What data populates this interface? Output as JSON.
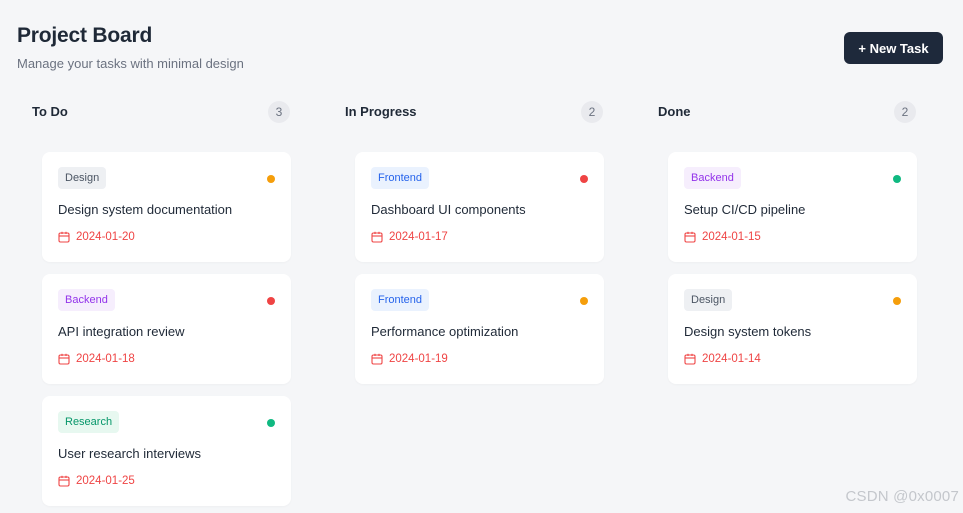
{
  "header": {
    "title": "Project Board",
    "subtitle": "Manage your tasks with minimal design"
  },
  "toolbar": {
    "new_task_label": "+ New Task"
  },
  "colors": {
    "primary_button": "#1e293b",
    "priority_high": "#ef4444",
    "priority_medium": "#f59e0b",
    "priority_low": "#10b981",
    "date_text": "#ef4444"
  },
  "icons": {
    "date": "calendar-icon"
  },
  "columns": [
    {
      "title": "To Do",
      "count": "3",
      "cards": [
        {
          "tag": "Design",
          "tag_type": "design",
          "priority": "orange",
          "title": "Design system documentation",
          "date": "2024-01-20"
        },
        {
          "tag": "Backend",
          "tag_type": "backend",
          "priority": "red",
          "title": "API integration review",
          "date": "2024-01-18"
        },
        {
          "tag": "Research",
          "tag_type": "research",
          "priority": "green",
          "title": "User research interviews",
          "date": "2024-01-25"
        }
      ]
    },
    {
      "title": "In Progress",
      "count": "2",
      "cards": [
        {
          "tag": "Frontend",
          "tag_type": "frontend",
          "priority": "red",
          "title": "Dashboard UI components",
          "date": "2024-01-17"
        },
        {
          "tag": "Frontend",
          "tag_type": "frontend",
          "priority": "orange",
          "title": "Performance optimization",
          "date": "2024-01-19"
        }
      ]
    },
    {
      "title": "Done",
      "count": "2",
      "cards": [
        {
          "tag": "Backend",
          "tag_type": "backend",
          "priority": "green",
          "title": "Setup CI/CD pipeline",
          "date": "2024-01-15"
        },
        {
          "tag": "Design",
          "tag_type": "design",
          "priority": "orange",
          "title": "Design system tokens",
          "date": "2024-01-14"
        }
      ]
    }
  ],
  "watermark": "CSDN @0x0007"
}
